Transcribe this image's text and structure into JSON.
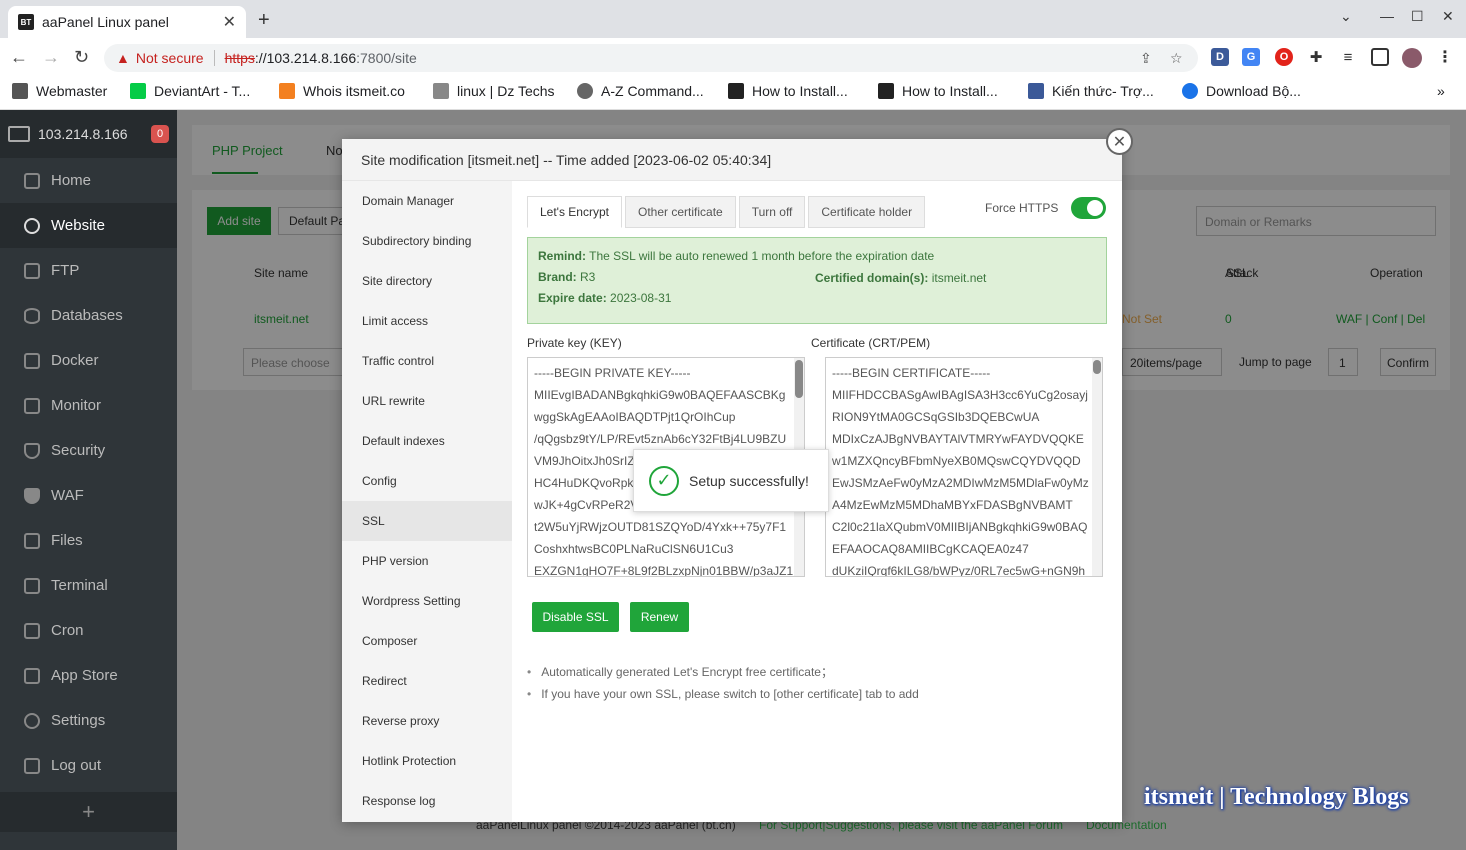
{
  "browser": {
    "tab_title": "aaPanel Linux panel",
    "favicon_text": "BT",
    "address": {
      "security_label": "Not secure",
      "scheme": "https",
      "host": "://103.214.8.166",
      "path": ":7800/site"
    },
    "bookmarks": [
      {
        "label": "Webmaster",
        "color": "#555555"
      },
      {
        "label": "DeviantArt - T...",
        "color": "#05cc47"
      },
      {
        "label": "Whois itsmeit.co",
        "color": "#f38020"
      },
      {
        "label": "linux | Dz Techs",
        "color": "#888888"
      },
      {
        "label": "A-Z Command...",
        "color": "#666666"
      },
      {
        "label": "How to Install...",
        "color": "#222222"
      },
      {
        "label": "How to Install...",
        "color": "#222222"
      },
      {
        "label": "Kiến thức- Trợ...",
        "color": "#3b5998"
      },
      {
        "label": "Download Bộ...",
        "color": "#1a73e8"
      }
    ]
  },
  "sidebar": {
    "server_ip": "103.214.8.166",
    "alert_count": "0",
    "items": [
      {
        "label": "Home"
      },
      {
        "label": "Website"
      },
      {
        "label": "FTP"
      },
      {
        "label": "Databases"
      },
      {
        "label": "Docker"
      },
      {
        "label": "Monitor"
      },
      {
        "label": "Security"
      },
      {
        "label": "WAF"
      },
      {
        "label": "Files"
      },
      {
        "label": "Terminal"
      },
      {
        "label": "Cron"
      },
      {
        "label": "App Store"
      },
      {
        "label": "Settings"
      },
      {
        "label": "Log out"
      }
    ],
    "add_label": "+"
  },
  "background": {
    "tab_php": "PHP Project",
    "tab_other": "No",
    "add_site": "Add site",
    "default_page": "Default Pa",
    "search_placeholder": "Domain or Remarks",
    "col_site_name": "Site name",
    "col_ssl": "SSL",
    "col_attack": "Attack",
    "col_operation": "Operation",
    "row_site": "itsmeit.net",
    "row_ssl": "Not Set",
    "row_attack": "0",
    "row_ops": "WAF | Conf | Del",
    "batch_placeholder": "Please choose",
    "per_page": "20items/page",
    "jump_label": "Jump to page",
    "jump_value": "1",
    "confirm": "Confirm",
    "footer_copyright": "aaPanelLinux panel ©2014-2023 aaPanel (bt.cn)",
    "footer_support": "For Support|Suggestions, please visit the aaPanel Forum",
    "footer_docs": "Documentation"
  },
  "modal": {
    "title": "Site modification [itsmeit.net] -- Time added [2023-06-02 05:40:34]",
    "nav": [
      {
        "label": "Domain Manager"
      },
      {
        "label": "Subdirectory binding"
      },
      {
        "label": "Site directory"
      },
      {
        "label": "Limit access"
      },
      {
        "label": "Traffic control"
      },
      {
        "label": "URL rewrite"
      },
      {
        "label": "Default indexes"
      },
      {
        "label": "Config"
      },
      {
        "label": "SSL"
      },
      {
        "label": "PHP version"
      },
      {
        "label": "Wordpress Setting"
      },
      {
        "label": "Composer"
      },
      {
        "label": "Redirect"
      },
      {
        "label": "Reverse proxy"
      },
      {
        "label": "Hotlink Protection"
      },
      {
        "label": "Response log"
      }
    ],
    "ssl_tabs": [
      "Let's Encrypt",
      "Other certificate",
      "Turn off",
      "Certificate holder"
    ],
    "force_https_label": "Force HTTPS",
    "force_https_on": true,
    "remind_label": "Remind:",
    "remind_text": "The SSL will be auto renewed 1 month before the expiration date",
    "brand_label": "Brand:",
    "brand_value": "R3",
    "domains_label": "Certified domain(s):",
    "domains_value": "itsmeit.net",
    "expire_label": "Expire date:",
    "expire_value": "2023-08-31",
    "key_label": "Private key (KEY)",
    "cert_label": "Certificate (CRT/PEM)",
    "key_lines": [
      "-----BEGIN PRIVATE KEY-----",
      "MIIEvgIBADANBgkqhkiG9w0BAQEFAASCBKg",
      "wggSkAgEAAoIBAQDTPjt1QrOIhCup",
      "/qQgsbz9tY/LP/REvt5znAb6cY32FtBj4LU9BZU",
      "VM9JhOitxJh0SrIZ",
      "HC4HuDKQvoRpk",
      "wJK+4gCvRPeR2V",
      "t2W5uYjRWjzOUTD81SZQYoD/4Yxk++75y7F1",
      "CoshxhtwsBC0PLNaRuClSN6U1Cu3",
      "EXZGN1gHO7F+8L9f2BLzxpNjn01BBW/p3aJZ1"
    ],
    "cert_lines": [
      "-----BEGIN CERTIFICATE-----",
      "MIIFHDCCBASgAwIBAgISA3H3cc6YuCg2osayj",
      "RION9YtMA0GCSqGSIb3DQEBCwUA",
      "MDIxCzAJBgNVBAYTAlVTMRYwFAYDVQQKE",
      "w1MZXQncyBFbmNyeXB0MQswCQYDVQQD",
      "EwJSMzAeFw0yMzA2MDIwMzM5MDlaFw0yMz",
      "A4MzEwMzM5MDhaMBYxFDASBgNVBAMT",
      "C2l0c21laXQubmV0MIIBIjANBgkqhkiG9w0BAQ",
      "EFAAOCAQ8AMIIBCgKCAQEA0z47",
      "dUKziIQrqf6kILG8/bWPyz/0RL7ec5wG+nGN9h"
    ],
    "disable_ssl": "Disable SSL",
    "renew": "Renew",
    "notes": [
      "Automatically generated Let's Encrypt free certificate；",
      "If you have your own SSL, please switch to [other certificate] tab to add"
    ],
    "close": "✕"
  },
  "toast": {
    "message": "Setup successfully!"
  },
  "watermark": "itsmeit | Technology Blogs",
  "colors": {
    "accent": "#20a53a",
    "sidebar_bg": "#2f3539",
    "danger": "#c5221f"
  }
}
